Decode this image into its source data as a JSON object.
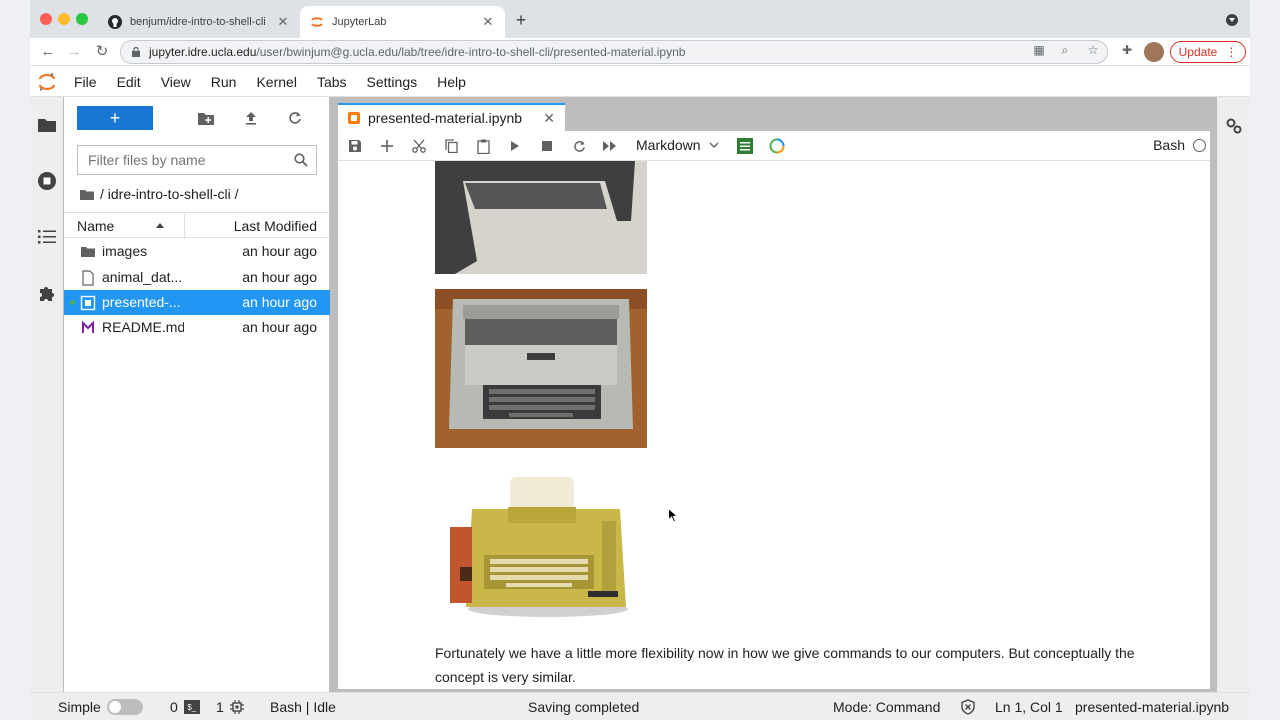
{
  "browser": {
    "tabs": [
      {
        "title": "benjum/idre-intro-to-shell-cli",
        "icon": "github-icon",
        "active": false
      },
      {
        "title": "JupyterLab",
        "icon": "jupyter-icon",
        "active": true
      }
    ],
    "url_host": "jupyter.idre.ucla.edu",
    "url_path": "/user/bwinjum@g.ucla.edu/lab/tree/idre-intro-to-shell-cli/presented-material.ipynb",
    "update_label": "Update"
  },
  "menu": {
    "items": [
      "File",
      "Edit",
      "View",
      "Run",
      "Kernel",
      "Tabs",
      "Settings",
      "Help"
    ]
  },
  "filebrowser": {
    "new_label": "+",
    "filter_placeholder": "Filter files by name",
    "breadcrumb": "/ idre-intro-to-shell-cli /",
    "col_name": "Name",
    "col_modified": "Last Modified",
    "files": [
      {
        "name": "images",
        "modified": "an hour ago",
        "icon": "folder-icon",
        "selected": false
      },
      {
        "name": "animal_dat...",
        "modified": "an hour ago",
        "icon": "file-icon",
        "selected": false
      },
      {
        "name": "presented-...",
        "modified": "an hour ago",
        "icon": "notebook-icon",
        "selected": true
      },
      {
        "name": "README.md",
        "modified": "an hour ago",
        "icon": "markdown-icon",
        "selected": false
      }
    ]
  },
  "notebook": {
    "tab_title": "presented-material.ipynb",
    "cell_type": "Markdown",
    "kernel_name": "Bash",
    "paragraph": "Fortunately we have a little more flexibility now in how we give commands to our computers. But conceptually the concept is very similar."
  },
  "status": {
    "simple_label": "Simple",
    "terminals_count": "0",
    "kernels_count": "1",
    "kernel_status": "Bash | Idle",
    "save_status": "Saving completed",
    "mode": "Mode: Command",
    "position": "Ln 1, Col 1",
    "filename": "presented-material.ipynb"
  },
  "colors": {
    "accent": "#2196f3",
    "new_button": "#1976d2",
    "update": "#d93025",
    "notebook_icon": "#f57c00"
  }
}
